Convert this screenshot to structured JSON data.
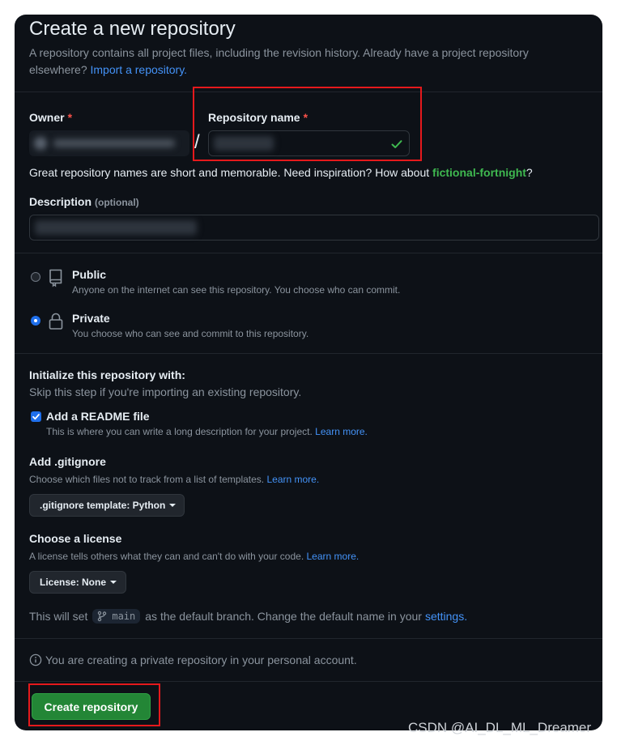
{
  "title": "Create a new repository",
  "subtitle": "A repository contains all project files, including the revision history. Already have a project repository elsewhere?",
  "import_link": "Import a repository.",
  "owner": {
    "label": "Owner",
    "required_mark": "*"
  },
  "separator": "/",
  "repo_name": {
    "label": "Repository name",
    "required_mark": "*"
  },
  "name_hint": {
    "text": "Great repository names are short and memorable. Need inspiration? How about",
    "suggestion": "fictional-fortnight",
    "end": "?"
  },
  "description": {
    "label": "Description",
    "optional": "(optional)"
  },
  "visibility": {
    "public": {
      "title": "Public",
      "desc": "Anyone on the internet can see this repository. You choose who can commit."
    },
    "private": {
      "title": "Private",
      "desc": "You choose who can see and commit to this repository."
    },
    "selected": "Private"
  },
  "init": {
    "heading": "Initialize this repository with:",
    "skip": "Skip this step if you're importing an existing repository.",
    "readme": {
      "label": "Add a README file",
      "desc": "This is where you can write a long description for your project.",
      "link": "Learn more.",
      "checked": true
    }
  },
  "gitignore": {
    "heading": "Add .gitignore",
    "desc": "Choose which files not to track from a list of templates.",
    "link": "Learn more.",
    "button": ".gitignore template: Python"
  },
  "license": {
    "heading": "Choose a license",
    "desc": "A license tells others what they can and can't do with your code.",
    "link": "Learn more.",
    "button": "License: None"
  },
  "branch": {
    "prefix": "This will set",
    "name": "main",
    "suffix": "as the default branch. Change the default name in your",
    "link": "settings."
  },
  "notice": "You are creating a private repository in your personal account.",
  "create_button": "Create repository",
  "watermark": "CSDN @AI_DL_ML_Dreamer",
  "colors": {
    "accent_link": "#4493f8",
    "primary_button": "#238636",
    "success": "#3fb950",
    "required": "#f85149",
    "highlight_box": "#e5191c"
  }
}
